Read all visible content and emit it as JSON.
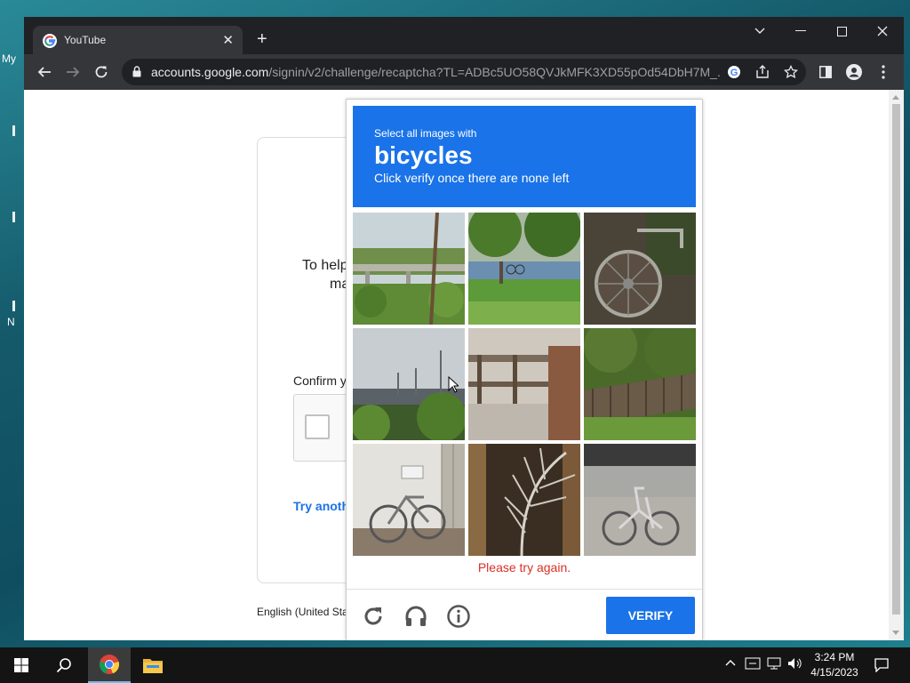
{
  "desktop": {
    "icon_label_1": "My",
    "icon_label_2": "N"
  },
  "browser": {
    "tab_title": "YouTube",
    "url_host": "accounts.google.com",
    "url_path": "/signin/v2/challenge/recaptcha?TL=ADBc5UO58QVJkMFK3XD55pOd54DbH7M_...",
    "accent": "#1a73e8"
  },
  "signin": {
    "help_text_line1": "To help",
    "help_text_line2": "ma",
    "confirm_text": "Confirm y",
    "try_another": "Try anoth",
    "language": "English (United Sta"
  },
  "captcha": {
    "prompt": "Select all images with",
    "target": "bicycles",
    "instruction": "Click verify once there are none left",
    "error": "Please try again.",
    "verify_label": "VERIFY",
    "tiles": [
      {
        "subject": "overpass-with-trees"
      },
      {
        "subject": "park-with-bikes"
      },
      {
        "subject": "bicycle-wheel-closeup"
      },
      {
        "subject": "highway-overpass"
      },
      {
        "subject": "wooden-bridge-railing"
      },
      {
        "subject": "tiled-roof-with-trees"
      },
      {
        "subject": "parked-bicycle-by-wall"
      },
      {
        "subject": "palm-frond"
      },
      {
        "subject": "folding-bicycle-on-street"
      }
    ],
    "footer_icons": [
      "reload-icon",
      "audio-headphones-icon",
      "info-icon"
    ]
  },
  "taskbar": {
    "time": "3:24 PM",
    "date": "4/15/2023"
  }
}
